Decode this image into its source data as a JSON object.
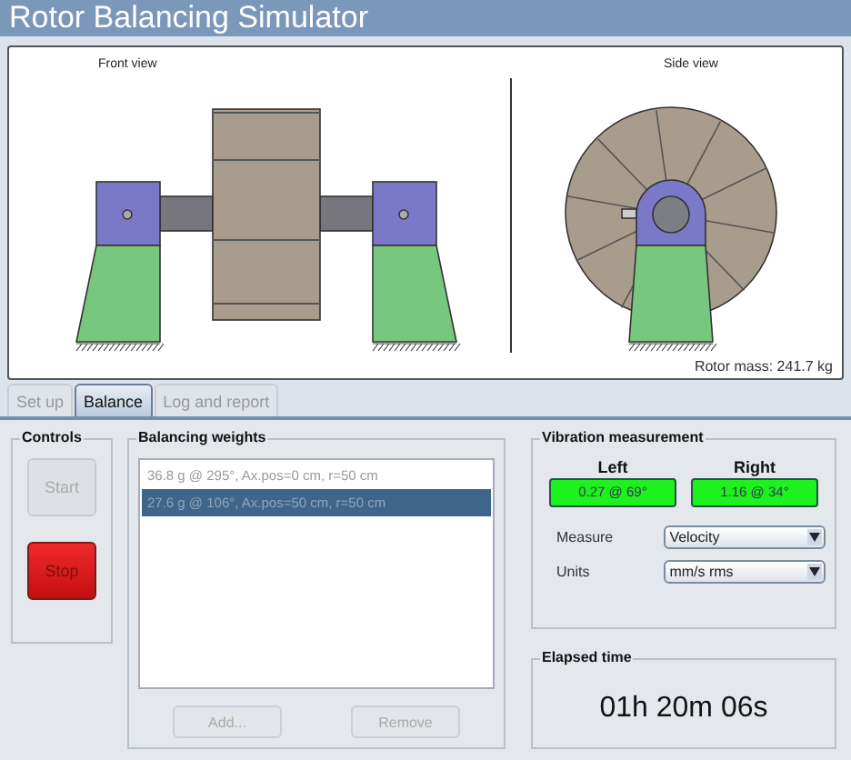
{
  "window": {
    "title": "Rotor Balancing Simulator"
  },
  "views": {
    "front_label": "Front view",
    "side_label": "Side view",
    "rotor_mass": "Rotor mass: 241.7 kg"
  },
  "tabs": [
    {
      "label": "Set up",
      "selected": false
    },
    {
      "label": "Balance",
      "selected": true
    },
    {
      "label": "Log and report",
      "selected": false
    }
  ],
  "controls": {
    "title": "Controls",
    "buttons": [
      {
        "label": "Start",
        "kind": "start",
        "disabled": true
      },
      {
        "label": "Stop",
        "kind": "stop",
        "disabled": false
      }
    ]
  },
  "weights": {
    "title": "Balancing weights",
    "items": [
      {
        "text": "36.8 g @ 295°, Ax.pos=0 cm, r=50 cm",
        "selected": false
      },
      {
        "text": "27.6 g @ 106°, Ax.pos=50 cm, r=50 cm",
        "selected": true
      }
    ],
    "buttons": [
      {
        "label": "Add...",
        "disabled": true
      },
      {
        "label": "Remove",
        "disabled": true
      }
    ]
  },
  "vibration": {
    "title": "Vibration measurement",
    "channels": [
      {
        "name": "Left",
        "reading": "0.27 @ 69°"
      },
      {
        "name": "Right",
        "reading": "1.16 @ 34°"
      }
    ],
    "selects": [
      {
        "label": "Measure",
        "value": "Velocity"
      },
      {
        "label": "Units",
        "value": "mm/s rms"
      }
    ]
  },
  "elapsed": {
    "title": "Elapsed time",
    "value": "01h 20m 06s"
  }
}
